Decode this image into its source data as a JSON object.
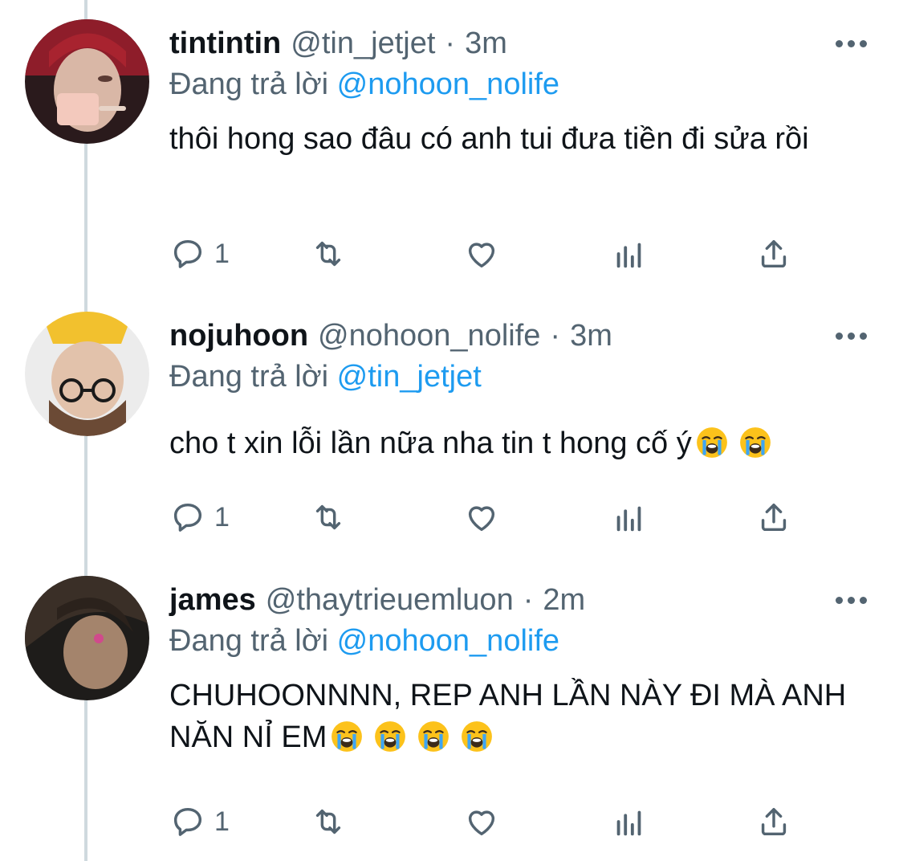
{
  "tweets": [
    {
      "name": "tintintin",
      "handle": "@tin_jetjet",
      "time": "3m",
      "replying_prefix": "Đang trả lời",
      "replying_to": "@nohoon_nolife",
      "text": "thôi hong sao đâu có anh tui đưa tiền đi sửa rồi",
      "emoji_count": 0,
      "reply_count": "1"
    },
    {
      "name": "nojuhoon",
      "handle": "@nohoon_nolife",
      "time": "3m",
      "replying_prefix": "Đang trả lời",
      "replying_to": "@tin_jetjet",
      "text": "cho t xin lỗi lần nữa nha tin t hong cố ý",
      "emoji_count": 2,
      "reply_count": "1"
    },
    {
      "name": "james",
      "handle": "@thaytrieuemluon",
      "time": "2m",
      "replying_prefix": "Đang trả lời",
      "replying_to": "@nohoon_nolife",
      "text": "CHUHOONNNN, REP ANH LẦN NÀY ĐI MÀ ANH NĂN NỈ EM",
      "emoji_count": 4,
      "reply_count": "1"
    }
  ],
  "separator": "·",
  "icons": [
    "reply-icon",
    "retweet-icon",
    "like-icon",
    "analytics-icon",
    "share-icon",
    "more-icon",
    "loudly-crying-face-emoji"
  ],
  "colors": {
    "text": "#0f1419",
    "secondary": "#536471",
    "link": "#1d9bf0",
    "thread_line": "#cfd9de",
    "background": "#ffffff"
  }
}
